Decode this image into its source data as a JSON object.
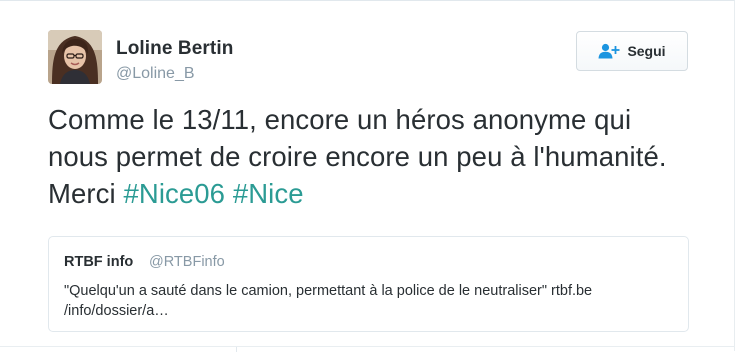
{
  "author": {
    "display_name": "Loline Bertin",
    "handle": "@Loline_B",
    "avatar": "avatar-photo"
  },
  "follow_button": {
    "label": "Segui",
    "icon": "follow-user-icon"
  },
  "tweet": {
    "text": "Comme le 13/11, encore un héros anonyme qui nous permet de croire encore un peu à l'humanité. Merci ",
    "hashtags": [
      "#Nice06",
      "#Nice"
    ]
  },
  "quoted_tweet": {
    "name": "RTBF info",
    "handle": "@RTBFinfo",
    "text": "\"Quelqu'un a sauté dans le camion, permettant à la police de le neutraliser\" rtbf.be /info/dossier/a…"
  },
  "colors": {
    "text": "#292f33",
    "secondary": "#8899a6",
    "hashtag": "#2b9b94",
    "border": "#e1e8ed",
    "follow_icon": "#1b95e0"
  }
}
